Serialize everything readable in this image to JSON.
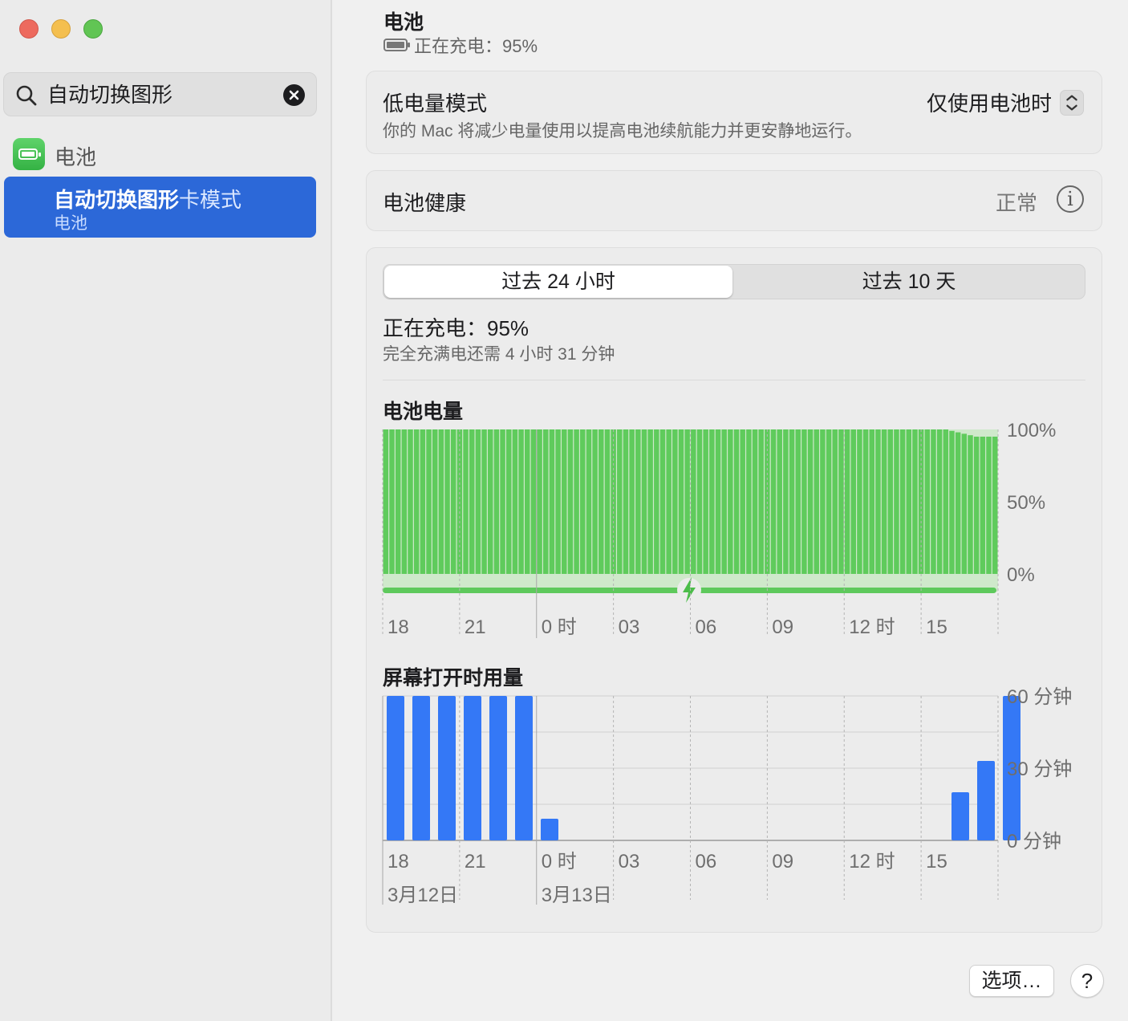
{
  "window": {
    "controls": [
      "close",
      "minimize",
      "zoom"
    ]
  },
  "sidebar": {
    "search": {
      "value": "自动切换图形",
      "icon": "search-icon",
      "clear_icon": "clear-icon"
    },
    "battery_label": "电池",
    "result": {
      "highlight": "自动切换图形",
      "rest": "卡模式",
      "subtitle": "电池"
    }
  },
  "header": {
    "title": "电池",
    "status": "正在充电：95%"
  },
  "low_power": {
    "title": "低电量模式",
    "description": "你的 Mac 将减少电量使用以提高电池续航能力并更安静地运行。",
    "selected": "仅使用电池时"
  },
  "health": {
    "title": "电池健康",
    "value": "正常"
  },
  "usage": {
    "tabs": [
      "过去 24 小时",
      "过去 10 天"
    ],
    "selected_tab": 0,
    "charge_status": "正在充电：95%",
    "charge_sub": "完全充满电还需 4 小时 31 分钟"
  },
  "colors": {
    "battery_green": "#5fcb5c",
    "screen_blue": "#3478f6",
    "selection_blue": "#2c68d8"
  },
  "chart_data": [
    {
      "type": "bar",
      "title": "电池电量",
      "x_ticks": [
        "18",
        "21",
        "0 时",
        "03",
        "06",
        "09",
        "12 时",
        "15"
      ],
      "y_ticks": [
        "100%",
        "50%",
        "0%"
      ],
      "ylim": [
        0,
        100
      ],
      "values": [
        100,
        100,
        100,
        100,
        100,
        100,
        100,
        100,
        100,
        100,
        100,
        100,
        100,
        100,
        100,
        100,
        100,
        100,
        100,
        100,
        100,
        100,
        100,
        100,
        100,
        100,
        100,
        100,
        100,
        100,
        100,
        100,
        100,
        100,
        100,
        100,
        100,
        100,
        100,
        100,
        100,
        100,
        100,
        100,
        100,
        100,
        100,
        100,
        100,
        100,
        100,
        100,
        100,
        100,
        100,
        100,
        100,
        100,
        100,
        100,
        100,
        100,
        100,
        100,
        100,
        100,
        100,
        100,
        100,
        100,
        100,
        100,
        100,
        100,
        100,
        100,
        100,
        100,
        100,
        100,
        100,
        100,
        100,
        100,
        100,
        100,
        100,
        100,
        100,
        100,
        100,
        100,
        99,
        98,
        97,
        96,
        95,
        95,
        95,
        95
      ],
      "charging": true
    },
    {
      "type": "bar",
      "title": "屏幕打开时用量",
      "x_ticks": [
        "18",
        "21",
        "0 时",
        "03",
        "06",
        "09",
        "12 时",
        "15"
      ],
      "y_ticks": [
        "60 分钟",
        "30 分钟",
        "0 分钟"
      ],
      "ylim": [
        0,
        60
      ],
      "values": [
        60,
        60,
        60,
        60,
        60,
        60,
        9,
        0,
        0,
        0,
        0,
        0,
        0,
        0,
        0,
        0,
        0,
        0,
        0,
        0,
        0,
        0,
        20,
        33,
        60
      ],
      "dates": [
        "3月12日",
        "3月13日"
      ]
    }
  ],
  "footer": {
    "options": "选项…",
    "help": "?"
  }
}
